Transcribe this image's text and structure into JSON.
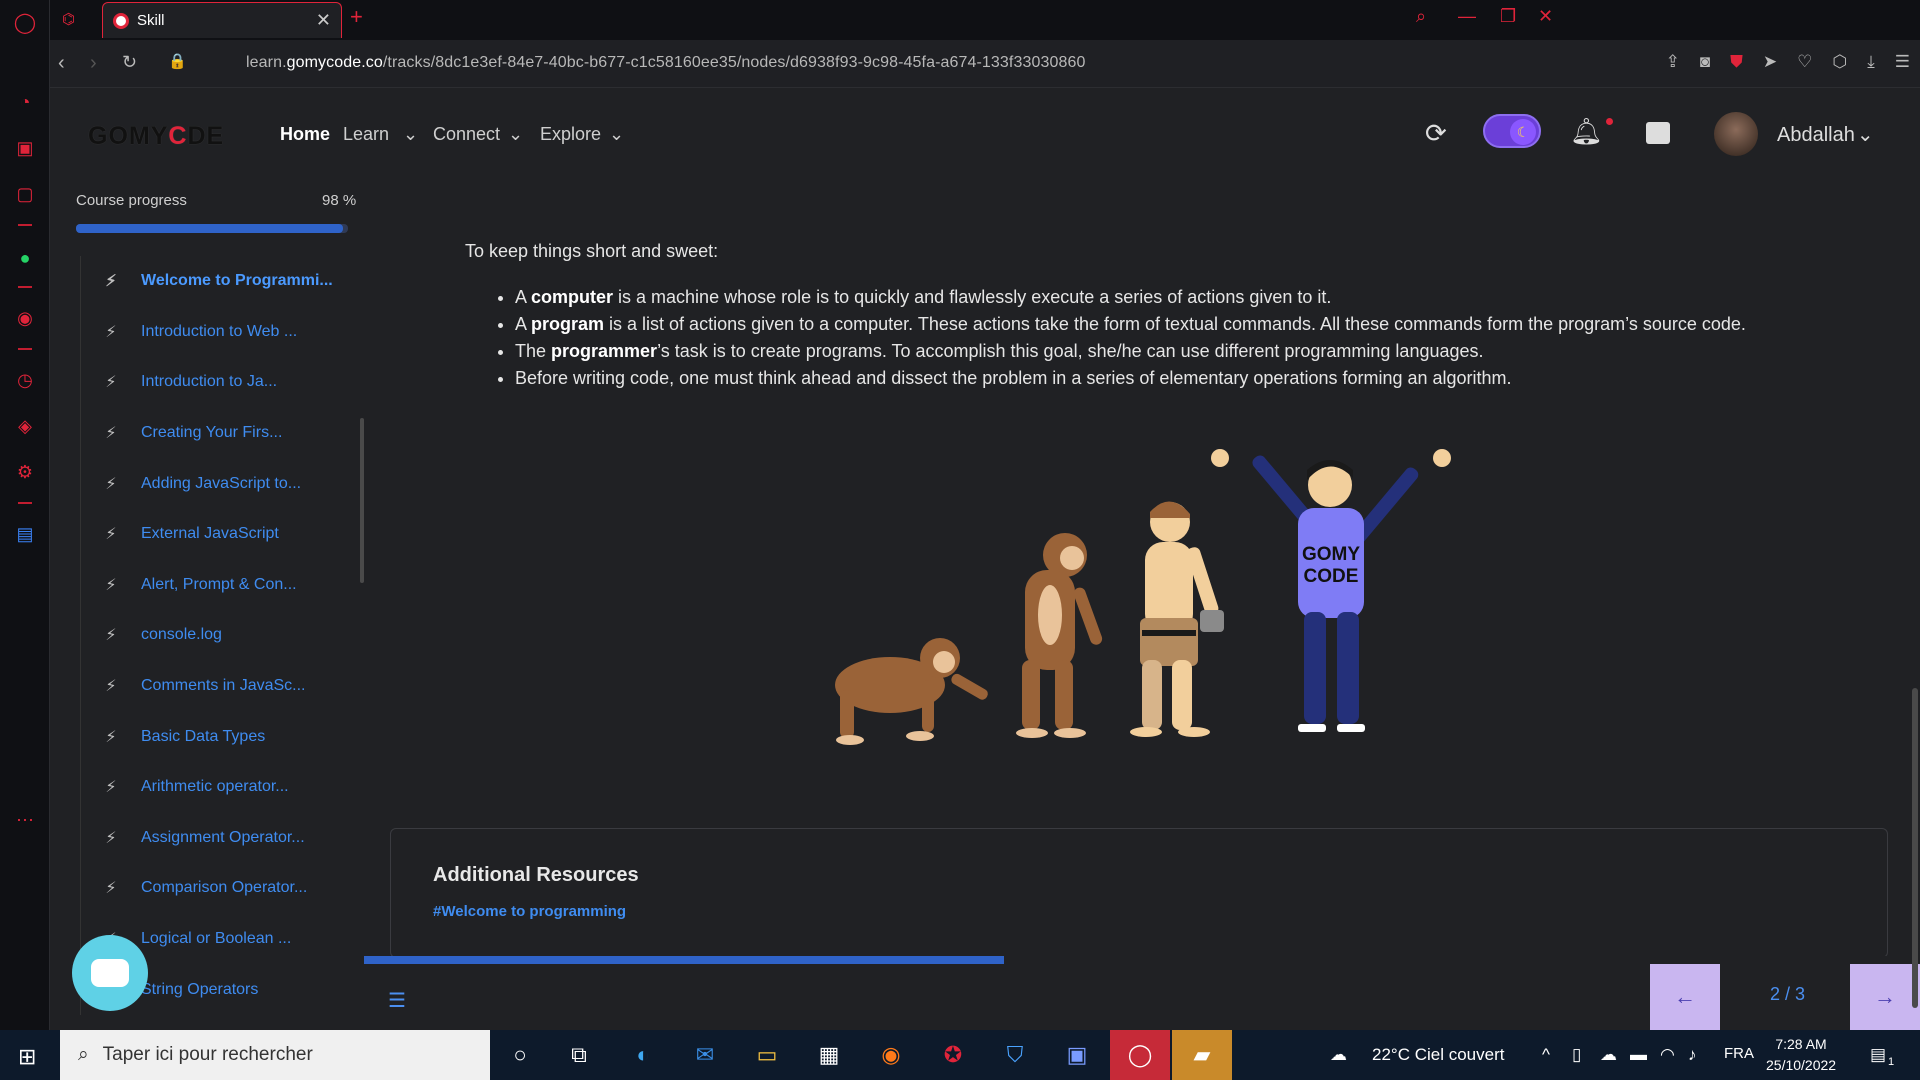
{
  "browser": {
    "tab_title": "Skill",
    "url_prefix": "learn.",
    "url_domain": "gomycode.co",
    "url_path": "/tracks/8dc1e3ef-84e7-40bc-b677-c1c58160ee35/nodes/d6938f93-9c98-45fa-a674-133f33030860"
  },
  "header": {
    "logo_pre": "GOMY",
    "logo_c": "C",
    "logo_post": "DE",
    "nav": {
      "home": "Home",
      "learn": "Learn",
      "connect": "Connect",
      "explore": "Explore"
    },
    "username": "Abdallah"
  },
  "course": {
    "progress_label": "Course progress",
    "progress_value": "98 %",
    "progress_fraction": 0.98,
    "items": [
      "Welcome to Programmi...",
      "Introduction to Web ...",
      "Introduction to Ja...",
      "Creating Your Firs...",
      "Adding JavaScript to...",
      "External JavaScript",
      "Alert, Prompt & Con...",
      "console.log",
      "Comments in JavaSc...",
      "Basic Data Types",
      "Arithmetic operator...",
      "Assignment Operator...",
      "Comparison Operator...",
      "Logical or Boolean ...",
      "String Operators"
    ]
  },
  "content": {
    "intro": "To keep things short and sweet:",
    "b1_pre": "A ",
    "b1_bold": "computer",
    "b1_post": " is a machine whose role is to quickly and flawlessly execute a series of actions given to it.",
    "b2_pre": "A ",
    "b2_bold": "program",
    "b2_post": " is a list of actions given to a computer. These actions take the form of textual commands. All these commands form the program’s source code.",
    "b3_pre": "The ",
    "b3_bold": "programmer",
    "b3_post": "’s task is to create programs. To accomplish this goal, she/he can use different programming languages.",
    "b4": "Before writing code, one must think ahead and dissect the problem in a series of elementary operations forming an algorithm.",
    "shirt_line1": "GOMY",
    "shirt_line2": "CODE"
  },
  "resources": {
    "title": "Additional Resources",
    "link": "#Welcome to programming"
  },
  "pager": {
    "label": "2 / 3",
    "fraction": 0.41
  },
  "taskbar": {
    "search_placeholder": "Taper ici pour rechercher",
    "weather": "22°C  Ciel couvert",
    "lang": "FRA",
    "time": "7:28 AM",
    "date": "25/10/2022",
    "notif_count": "1"
  }
}
